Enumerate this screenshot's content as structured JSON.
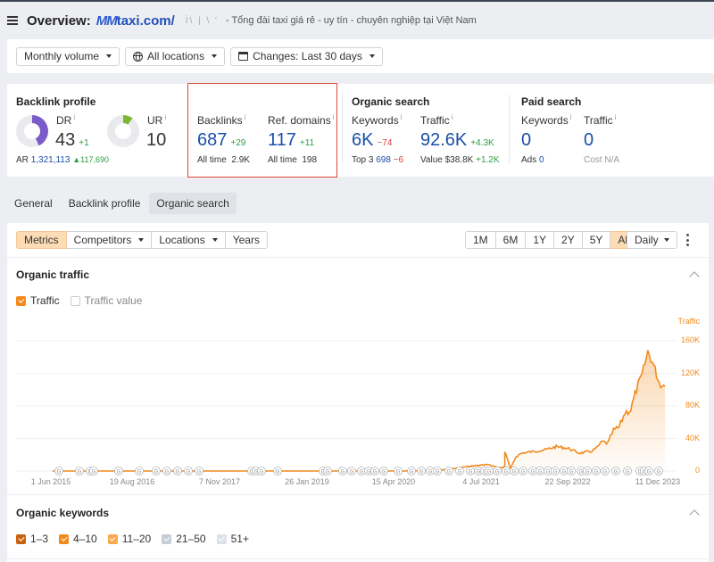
{
  "header": {
    "title": "Overview:",
    "domain": "taxi.com/",
    "domain_obscured_prefix": "MM",
    "obscured_text": "İ\\ | \\ '",
    "subtitle": "- Tổng đài taxi giá rẻ - uy tín - chuyên nghiệp tại Việt Nam"
  },
  "filters": {
    "volume": "Monthly volume",
    "locations": "All locations",
    "changes": "Changes: Last 30 days"
  },
  "backlink_profile": {
    "title": "Backlink profile",
    "dr_label": "DR",
    "dr_value": "43",
    "dr_delta": "+1",
    "dr_fraction": 0.43,
    "ur_label": "UR",
    "ur_value": "10",
    "ur_fraction": 0.1,
    "ar_label": "AR",
    "ar_value": "1,321,113",
    "ar_delta": "▲117,690",
    "info": "i"
  },
  "links": {
    "backlinks_label": "Backlinks",
    "backlinks_value": "687",
    "backlinks_delta": "+29",
    "backlinks_alltime_label": "All time",
    "backlinks_alltime": "2.9K",
    "refdomains_label": "Ref. domains",
    "refdomains_value": "117",
    "refdomains_delta": "+11",
    "refdomains_alltime_label": "All time",
    "refdomains_alltime": "198"
  },
  "organic_search": {
    "title": "Organic search",
    "keywords_label": "Keywords",
    "keywords_value": "6K",
    "keywords_delta": "−74",
    "top3_label": "Top 3",
    "top3_value": "698",
    "top3_delta": "−6",
    "traffic_label": "Traffic",
    "traffic_value": "92.6K",
    "traffic_delta": "+4.3K",
    "value_label": "Value",
    "value_value": "$38.8K",
    "value_delta": "+1.2K"
  },
  "paid_search": {
    "title": "Paid search",
    "keywords_label": "Keywords",
    "keywords_value": "0",
    "traffic_label": "Traffic",
    "traffic_value": "0",
    "ads_label": "Ads",
    "ads_value": "0",
    "cost_label": "Cost",
    "cost_value": "N/A"
  },
  "tabs": [
    {
      "label": "General",
      "active": false
    },
    {
      "label": "Backlink profile",
      "active": false
    },
    {
      "label": "Organic search",
      "active": true
    }
  ],
  "toolbar": {
    "views": [
      {
        "label": "Metrics",
        "selected": true,
        "dropdown": false
      },
      {
        "label": "Competitors",
        "selected": false,
        "dropdown": true
      },
      {
        "label": "Locations",
        "selected": false,
        "dropdown": true
      },
      {
        "label": "Years",
        "selected": false,
        "dropdown": false
      }
    ],
    "ranges": [
      {
        "label": "1M",
        "selected": false
      },
      {
        "label": "6M",
        "selected": false
      },
      {
        "label": "1Y",
        "selected": false
      },
      {
        "label": "2Y",
        "selected": false
      },
      {
        "label": "5Y",
        "selected": false
      },
      {
        "label": "All",
        "selected": true
      }
    ],
    "granularity": "Daily"
  },
  "organic_traffic": {
    "title": "Organic traffic",
    "checkboxes": [
      {
        "label": "Traffic",
        "checked": true
      },
      {
        "label": "Traffic value",
        "checked": false
      }
    ]
  },
  "organic_keywords": {
    "title": "Organic keywords",
    "checkboxes": [
      {
        "label": "1–3",
        "checked": true,
        "color": "#c9620f"
      },
      {
        "label": "4–10",
        "checked": true,
        "color": "#f28a1b"
      },
      {
        "label": "11–20",
        "checked": true,
        "color": "#f7a94b"
      },
      {
        "label": "21–50",
        "checked": true,
        "color": "#c5cdd6"
      },
      {
        "label": "51+",
        "checked": true,
        "color": "#dde2e8"
      }
    ]
  },
  "colors": {
    "accent": "#f28a1b",
    "link_blue": "#1a4fa8",
    "positive": "#2e9e43",
    "negative": "#d83a3a",
    "highlight_border": "#e0473b",
    "dr_donut": "#7a5cc8",
    "ur_donut": "#7ab834"
  },
  "chart_data": {
    "type": "area",
    "title": "Organic traffic",
    "series_name": "Traffic",
    "ylabel": "Traffic",
    "ylim": [
      0,
      170000
    ],
    "yticks": [
      0,
      40000,
      80000,
      120000,
      160000
    ],
    "ytick_labels": [
      "0",
      "40K",
      "80K",
      "120K",
      "160K"
    ],
    "xtick_labels": [
      "1 Jun 2015",
      "19 Aug 2016",
      "7 Nov 2017",
      "26 Jan 2019",
      "15 Apr 2020",
      "4 Jul 2021",
      "22 Sep 2022",
      "11 Dec 2023"
    ],
    "x_dates": [
      "2015-03",
      "2015-06",
      "2016-01",
      "2016-08",
      "2017-03",
      "2017-11",
      "2018-06",
      "2019-01",
      "2019-08",
      "2020-04",
      "2020-10",
      "2021-01",
      "2021-04",
      "2021-07",
      "2021-09",
      "2021-10",
      "2021-10",
      "2021-11",
      "2021-12",
      "2022-01",
      "2022-03",
      "2022-05",
      "2022-07",
      "2022-09",
      "2022-11",
      "2023-01",
      "2023-02",
      "2023-03",
      "2023-04",
      "2023-05",
      "2023-06",
      "2023-07",
      "2023-08",
      "2023-09",
      "2023-10",
      "2023-11",
      "2023-12",
      "2024-01",
      "2024-02"
    ],
    "values": [
      0,
      0,
      0,
      0,
      0,
      0,
      0,
      0,
      0,
      0,
      500,
      3000,
      6000,
      8000,
      4000,
      5000,
      24000,
      3000,
      18000,
      22000,
      24000,
      26000,
      30000,
      28000,
      22000,
      24000,
      28000,
      36000,
      34000,
      50000,
      54000,
      72000,
      75000,
      100000,
      118000,
      147000,
      130000,
      108000,
      104000
    ],
    "grid": true,
    "legend": "none",
    "annotation_markers": "G (Google update) markers along the baseline"
  }
}
